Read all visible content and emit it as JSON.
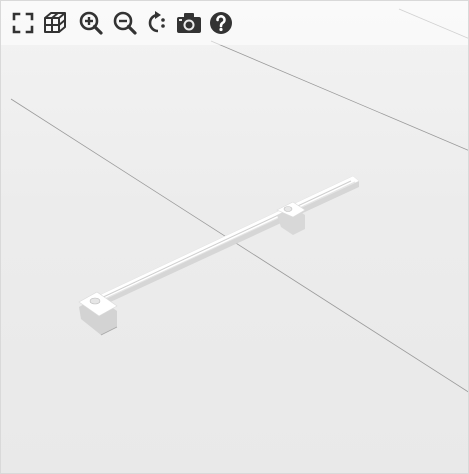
{
  "viewer": {
    "label": "3D model viewer"
  },
  "toolbar": {
    "tools": [
      {
        "name": "fullscreen",
        "icon": "fullscreen-icon"
      },
      {
        "name": "wireframe",
        "icon": "wireframe-cube-icon"
      },
      {
        "name": "zoom-in",
        "icon": "zoom-in-icon"
      },
      {
        "name": "zoom-out",
        "icon": "zoom-out-icon"
      },
      {
        "name": "rotate",
        "icon": "rotate-icon"
      },
      {
        "name": "screenshot",
        "icon": "camera-icon"
      },
      {
        "name": "help",
        "icon": "help-icon"
      }
    ],
    "icon_color": "#333333"
  },
  "scene": {
    "background_color": "#ececec",
    "model_color": "#ffffff",
    "grid_line_color": "#9a9a9a"
  }
}
